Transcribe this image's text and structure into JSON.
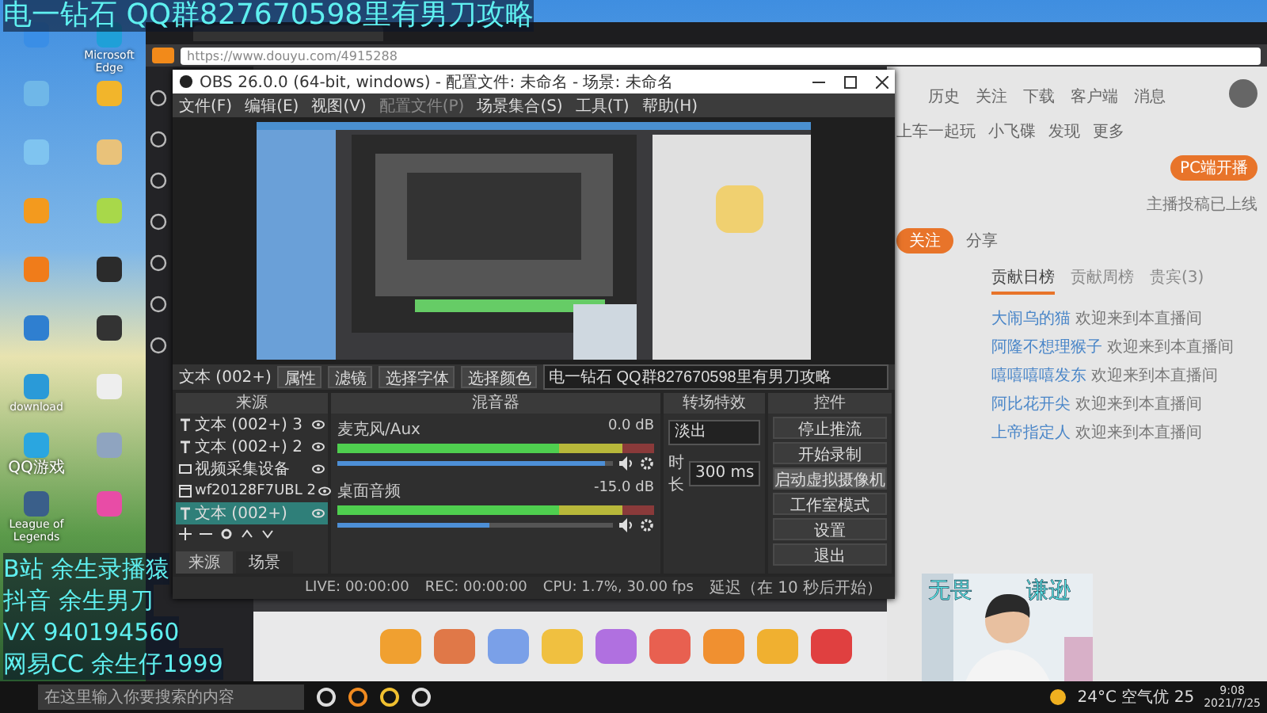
{
  "desktop_icons": [
    {
      "color": "#3a8ee6"
    },
    {
      "label": "Microsoft Edge",
      "color": "#1fa0d8"
    },
    {
      "color": "#6fb7e8"
    },
    {
      "color": "#f2b52b"
    },
    {
      "color": "#7fc4f0"
    },
    {
      "color": "#e9c27a"
    },
    {
      "color": "#f39a1e"
    },
    {
      "color": "#a8d84a"
    },
    {
      "color": "#f07c1a"
    },
    {
      "color": "#2b2b2b"
    },
    {
      "color": "#2f7fd0"
    },
    {
      "color": "#333333"
    },
    {
      "label": "download",
      "color": "#2a9ad8"
    },
    {
      "color": "#eeeeee"
    },
    {
      "label": "QQ游戏",
      "color": "#2aa6e0"
    },
    {
      "color": "#8fa4c0"
    },
    {
      "label": "League of Legends",
      "color": "#3a5f8a"
    },
    {
      "color": "#e84ca6"
    }
  ],
  "overlay_top": "电一钻石 QQ群827670598里有男刀攻略",
  "overlay_bottom": [
    "B站 余生录播猿",
    "抖音 余生男刀",
    "VX 940194560",
    "网易CC 余生仔1999"
  ],
  "browser": {
    "address": "https://www.douyu.com/4915288",
    "douyu_panel": {
      "nav": [
        "历史",
        "关注",
        "下载",
        "客户端",
        "消息"
      ],
      "shortcuts": [
        "上车一起玩",
        "小飞碟",
        "发现",
        "更多"
      ],
      "pc_button": "PC端开播",
      "pc_note": "主播投稿已上线",
      "follow": "关注",
      "share": "分享",
      "tabs": [
        {
          "label": "贡献日榜",
          "selected": true
        },
        {
          "label": "贡献周榜",
          "selected": false
        },
        {
          "label": "贵宾(3)",
          "selected": false
        }
      ],
      "chat": [
        {
          "name": "大闹乌的猫",
          "text": "欢迎来到本直播间"
        },
        {
          "name": "阿隆不想理猴子",
          "text": "欢迎来到本直播间"
        },
        {
          "name": "嘻嘻嘻嘻发东",
          "text": "欢迎来到本直播间"
        },
        {
          "name": "阿比花开尖",
          "text": "欢迎来到本直播间"
        },
        {
          "name": "上帝指定人",
          "text": "欢迎来到本直播间"
        }
      ]
    }
  },
  "obs": {
    "title": "OBS 26.0.0 (64-bit, windows) - 配置文件: 未命名 - 场景: 未命名",
    "menu": [
      "文件(F)",
      "编辑(E)",
      "视图(V)",
      "配置文件(P)",
      "场景集合(S)",
      "工具(T)",
      "帮助(H)"
    ],
    "toolbar": {
      "source": "文本 (002+)",
      "buttons": [
        "属性",
        "滤镜",
        "选择字体",
        "选择颜色"
      ],
      "text_value": "电一钻石 QQ群827670598里有男刀攻略"
    },
    "sources": {
      "title": "来源",
      "items": [
        {
          "label": "文本 (002+) 3",
          "kind": "text",
          "selected": false
        },
        {
          "label": "文本 (002+) 2",
          "kind": "text",
          "selected": false
        },
        {
          "label": "视频采集设备",
          "kind": "camera",
          "selected": false
        },
        {
          "label": "wf20128F7UBL 2",
          "kind": "window",
          "selected": false
        },
        {
          "label": "文本 (002+)",
          "kind": "text",
          "selected": true
        }
      ],
      "tabs": [
        {
          "label": "来源",
          "selected": true
        },
        {
          "label": "场景",
          "selected": false
        }
      ]
    },
    "mixer": {
      "title": "混音器",
      "channels": [
        {
          "name": "麦克风/Aux",
          "reading": "0.0 dB",
          "level": 0.97
        },
        {
          "name": "桌面音频",
          "reading": "-15.0 dB",
          "level": 0.55
        }
      ]
    },
    "transitions": {
      "title": "转场特效",
      "type": "淡出",
      "duration_label": "时长",
      "duration": "300 ms"
    },
    "controls": {
      "title": "控件",
      "buttons": [
        {
          "label": "停止推流",
          "selected": false
        },
        {
          "label": "开始录制",
          "selected": false
        },
        {
          "label": "启动虚拟摄像机",
          "selected": true
        },
        {
          "label": "工作室模式",
          "selected": false
        },
        {
          "label": "设置",
          "selected": false
        },
        {
          "label": "退出",
          "selected": false
        }
      ]
    },
    "status": [
      "LIVE: 00:00:00",
      "REC: 00:00:00",
      "CPU: 1.7%, 30.00 fps",
      "延迟（在 10 秒后开始）"
    ]
  },
  "webcam": {
    "captions": [
      "无畏",
      "谦逊"
    ]
  },
  "taskbar": {
    "search_placeholder": "在这里输入你要搜索的内容",
    "weather": "24°C 空气优 25",
    "time": "9:08",
    "date": "2021/7/25"
  }
}
